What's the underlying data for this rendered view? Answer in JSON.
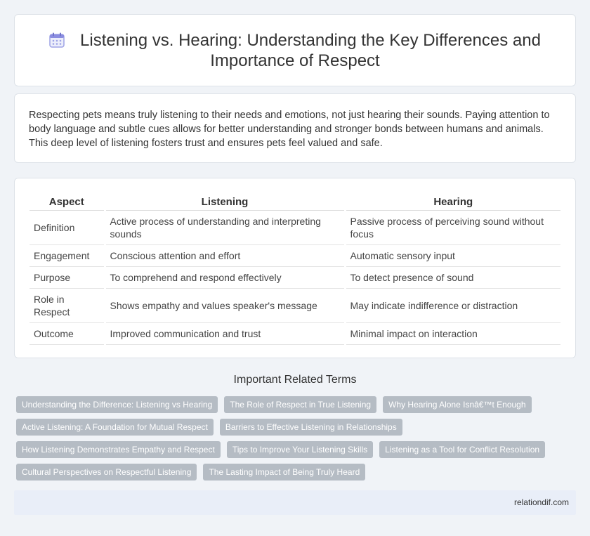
{
  "header": {
    "title": "Listening vs. Hearing: Understanding the Key Differences and Importance of Respect",
    "icon": "calendar-icon"
  },
  "intro": {
    "text": "Respecting pets means truly listening to their needs and emotions, not just hearing their sounds. Paying attention to body language and subtle cues allows for better understanding and stronger bonds between humans and animals. This deep level of listening fosters trust and ensures pets feel valued and safe."
  },
  "table": {
    "headers": [
      "Aspect",
      "Listening",
      "Hearing"
    ],
    "rows": [
      [
        "Definition",
        "Active process of understanding and interpreting sounds",
        "Passive process of perceiving sound without focus"
      ],
      [
        "Engagement",
        "Conscious attention and effort",
        "Automatic sensory input"
      ],
      [
        "Purpose",
        "To comprehend and respond effectively",
        "To detect presence of sound"
      ],
      [
        "Role in Respect",
        "Shows empathy and values speaker's message",
        "May indicate indifference or distraction"
      ],
      [
        "Outcome",
        "Improved communication and trust",
        "Minimal impact on interaction"
      ]
    ]
  },
  "related": {
    "title": "Important Related Terms",
    "tags": [
      "Understanding the Difference: Listening vs Hearing",
      "The Role of Respect in True Listening",
      "Why Hearing Alone Isnâ€™t Enough",
      "Active Listening: A Foundation for Mutual Respect",
      "Barriers to Effective Listening in Relationships",
      "How Listening Demonstrates Empathy and Respect",
      "Tips to Improve Your Listening Skills",
      "Listening as a Tool for Conflict Resolution",
      "Cultural Perspectives on Respectful Listening",
      "The Lasting Impact of Being Truly Heard"
    ]
  },
  "footer": {
    "site": "relationdif.com"
  },
  "colors": {
    "background": "#f0f3f7",
    "tag": "#b5bcc4",
    "footer": "#e9eef8",
    "icon_accent": "#8b8de0"
  }
}
